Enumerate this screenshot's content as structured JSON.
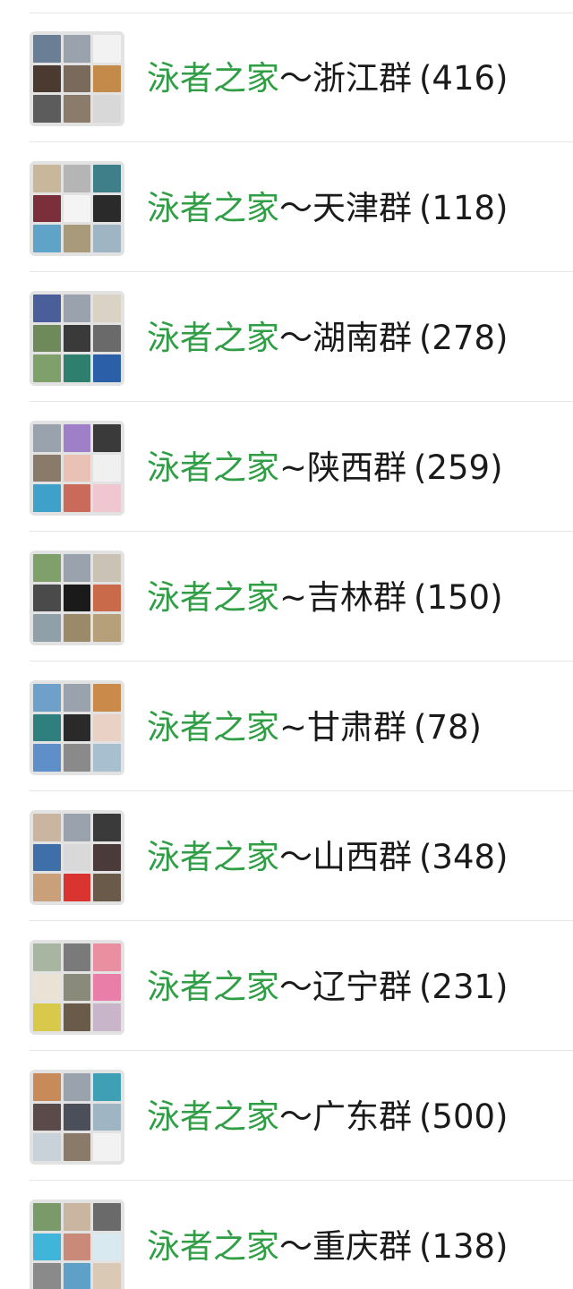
{
  "chat_list": {
    "items": [
      {
        "group_name": "泳者之家",
        "suffix": "～浙江群",
        "count": "(416)"
      },
      {
        "group_name": "泳者之家",
        "suffix": "～天津群",
        "count": "(118)"
      },
      {
        "group_name": "泳者之家",
        "suffix": "～湖南群",
        "count": "(278)"
      },
      {
        "group_name": "泳者之家",
        "suffix": "~陕西群",
        "count": "(259)"
      },
      {
        "group_name": "泳者之家",
        "suffix": "~吉林群",
        "count": "(150)"
      },
      {
        "group_name": "泳者之家",
        "suffix": "~甘肃群",
        "count": "(78)"
      },
      {
        "group_name": "泳者之家",
        "suffix": "～山西群",
        "count": "(348)"
      },
      {
        "group_name": "泳者之家",
        "suffix": "～辽宁群",
        "count": "(231)"
      },
      {
        "group_name": "泳者之家",
        "suffix": "～广东群",
        "count": "(500)"
      },
      {
        "group_name": "泳者之家",
        "suffix": "～重庆群",
        "count": "(138)"
      }
    ]
  },
  "colors": {
    "group_name": "#2f9e44",
    "text": "#1a1a1a",
    "divider": "#e6e6e6",
    "avatar_bg": "#e2e2e2"
  },
  "avatar_tiles": [
    [
      "#6a7f95",
      "#9aa3ad",
      "#f2f2f2",
      "#4b3a2f",
      "#7a6a5c",
      "#c48a4a",
      "#5c5c5c",
      "#8a7b6a",
      "#d8d8d8"
    ],
    [
      "#c9b79c",
      "#b5b5b5",
      "#3f7f8a",
      "#7a2f3a",
      "#f4f4f4",
      "#2a2a2a",
      "#5fa3c9",
      "#a89a7a",
      "#9fb5c4"
    ],
    [
      "#4a5f9a",
      "#9aa3ad",
      "#d9d2c5",
      "#6f8a5a",
      "#3a3a3a",
      "#6a6a6a",
      "#7fa06a",
      "#2f7f6f",
      "#2b5fa8"
    ],
    [
      "#9aa3ad",
      "#a07fc9",
      "#3a3a3a",
      "#8a7a6a",
      "#e9c2b5",
      "#f0f0f0",
      "#3fa0c9",
      "#c96a5a",
      "#f0c6d0"
    ],
    [
      "#7fa06a",
      "#9aa3ad",
      "#c9c2b5",
      "#4a4a4a",
      "#1a1a1a",
      "#c96a4a",
      "#8fa0a8",
      "#9a8a6a",
      "#b5a07a"
    ],
    [
      "#6fa0c9",
      "#9aa3ad",
      "#c98a4a",
      "#2f7f7f",
      "#2a2a2a",
      "#e9d2c5",
      "#5f8fc9",
      "#8a8a8a",
      "#a8bfd0"
    ],
    [
      "#c9b5a0",
      "#9aa3ad",
      "#3a3a3a",
      "#3f6fa8",
      "#d9d9d9",
      "#4a3a3a",
      "#c9a07a",
      "#d9342f",
      "#6a5a4a"
    ],
    [
      "#a8b5a0",
      "#7a7a7a",
      "#e98fa0",
      "#e9e2d5",
      "#8a8a7a",
      "#e97fa8",
      "#d9c94a",
      "#6a5a4a",
      "#c9b5c9"
    ],
    [
      "#c98a5a",
      "#9aa3ad",
      "#3fa0b5",
      "#5a4a4a",
      "#4a4f5a",
      "#9fb5c4",
      "#c9d2d9",
      "#8a7a6a",
      "#f2f2f2"
    ],
    [
      "#7a9a6a",
      "#c9b5a0",
      "#6a6a6a",
      "#3fb5d9",
      "#c98a7a",
      "#d9e9f0",
      "#8a8a8a",
      "#5fa0c9",
      "#d9c9b5"
    ]
  ]
}
